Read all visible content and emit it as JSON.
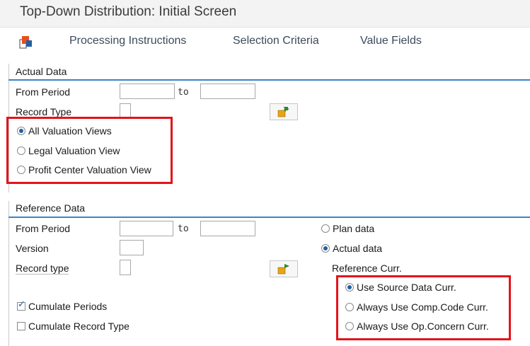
{
  "window": {
    "title": "Top-Down Distribution: Initial Screen"
  },
  "toolbar": {
    "processing_instructions": "Processing Instructions",
    "selection_criteria": "Selection Criteria",
    "value_fields": "Value Fields"
  },
  "actual": {
    "group_title": "Actual Data",
    "from_period_label": "From Period",
    "to_label": "to",
    "record_type_label": "Record Type",
    "valuation": {
      "all": "All Valuation Views",
      "legal": "Legal Valuation View",
      "profit_center": "Profit Center Valuation View",
      "selected": "all"
    }
  },
  "reference": {
    "group_title": "Reference Data",
    "from_period_label": "From Period",
    "to_label": "to",
    "version_label": "Version",
    "record_type_label": "Record type",
    "plan_data": "Plan data",
    "actual_data": "Actual data",
    "ref_curr_label": "Reference Curr.",
    "use_source": "Use Source Data Curr.",
    "comp_code": "Always Use Comp.Code Curr.",
    "op_concern": "Always Use Op.Concern Curr.",
    "cumulate_periods": "Cumulate Periods",
    "cumulate_record_type": "Cumulate Record Type"
  },
  "colors": {
    "highlight": "#e5131b",
    "accent": "#3b84c8"
  }
}
